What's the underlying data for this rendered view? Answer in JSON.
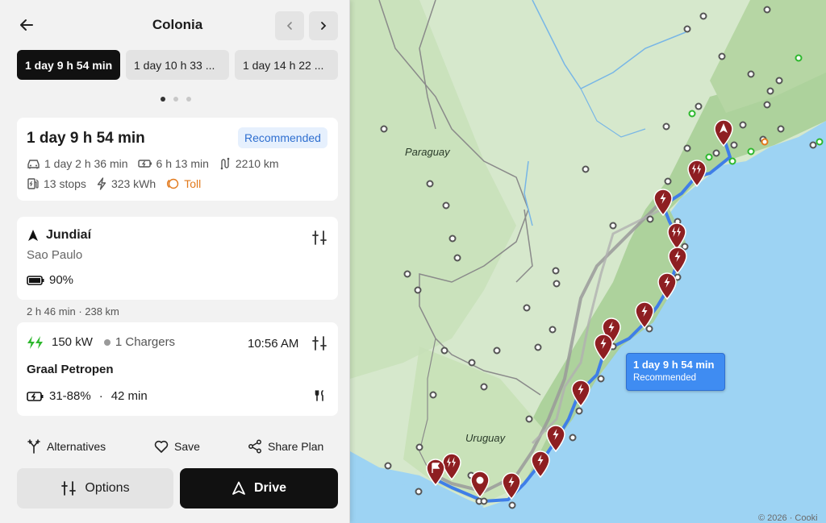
{
  "header": {
    "title": "Colonia"
  },
  "route_tabs": [
    {
      "label": "1 day 9 h 54 min",
      "active": true
    },
    {
      "label": "1 day 10 h 33 ...",
      "active": false
    },
    {
      "label": "1 day 14 h 22 ...",
      "active": false
    }
  ],
  "pager": {
    "count": 3,
    "active_index": 0
  },
  "summary": {
    "total_time": "1 day 9 h 54 min",
    "badge": "Recommended",
    "drive_time": "1 day 2 h 36 min",
    "charge_time": "6 h 13 min",
    "distance": "2210 km",
    "stops": "13 stops",
    "energy": "323 kWh",
    "toll": "Toll"
  },
  "origin": {
    "name": "Jundiaí",
    "region": "Sao Paulo",
    "battery": "90%"
  },
  "leg": {
    "info": "2 h 46 min · 238 km"
  },
  "stop": {
    "power": "150 kW",
    "chargers": "1 Chargers",
    "time": "10:56 AM",
    "name": "Graal Petropen",
    "charge_range": "31-88%",
    "separator": "·",
    "charge_duration": "42 min"
  },
  "actions": {
    "alternatives": "Alternatives",
    "save": "Save",
    "share": "Share Plan"
  },
  "buttons": {
    "options": "Options",
    "drive": "Drive"
  },
  "map": {
    "label_paraguay": "Paraguay",
    "label_uruguay": "Uruguay",
    "tooltip_time": "1 day 9 h 54 min",
    "tooltip_sub": "Recommended",
    "attribution": "© 2026 · Cooki"
  },
  "colors": {
    "route": "#3f7ee8",
    "marker": "#8e1f22",
    "accent": "#2f6fd0",
    "charge_green": "#2eb82e",
    "toll": "#e27a1d"
  }
}
